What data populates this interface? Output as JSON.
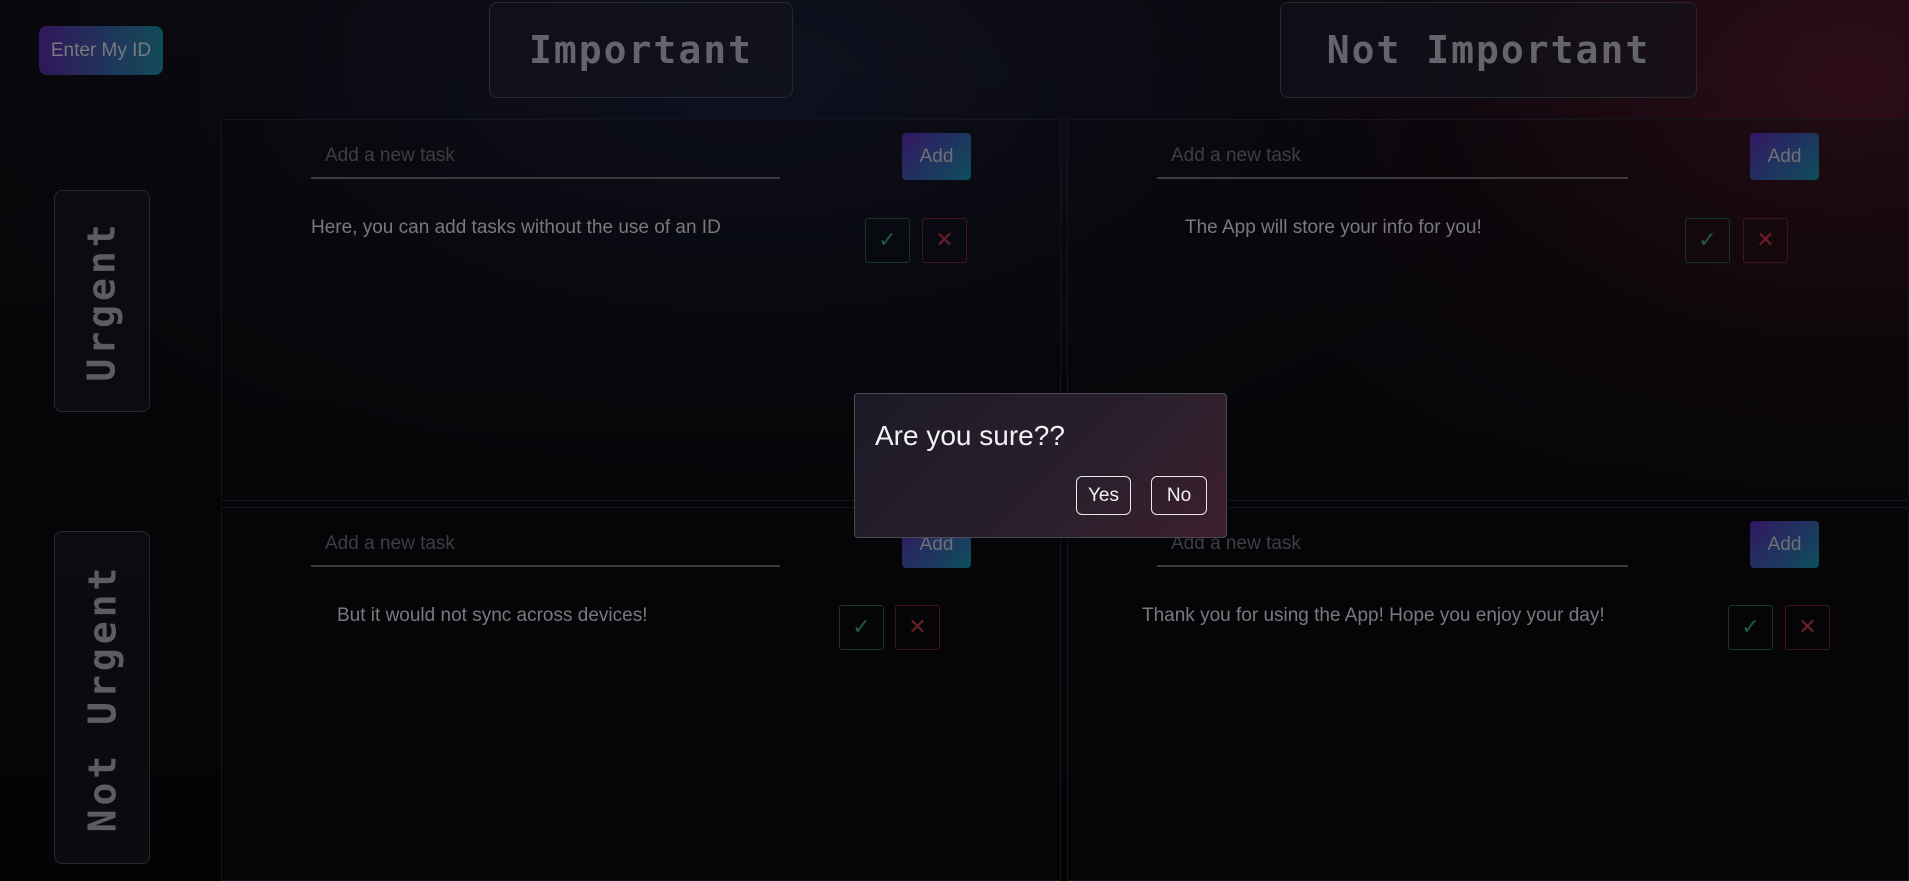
{
  "enter_id_label": "Enter My ID",
  "columns": {
    "important": "Important",
    "not_important": "Not Important"
  },
  "rows": {
    "urgent": "Urgent",
    "not_urgent": "Not Urgent"
  },
  "input_placeholder": "Add a new task",
  "add_label": "Add",
  "check_glyph": "✓",
  "x_glyph": "✕",
  "quadrants": {
    "urgent_important": {
      "task": "Here, you can add tasks without the use of an ID"
    },
    "urgent_not_important": {
      "task": "The App will store your info for you!"
    },
    "not_urgent_important": {
      "task": "But it would not sync across devices!"
    },
    "not_urgent_not_important": {
      "task": "Thank you for using the App! Hope you enjoy your day!"
    }
  },
  "dialog": {
    "title": "Are you sure??",
    "yes": "Yes",
    "no": "No"
  },
  "colors": {
    "accent_gradient_start": "#5b2ab3",
    "accent_gradient_end": "#1a8ea6",
    "check_color": "#2d8a66",
    "delete_color": "#a32f3e"
  }
}
